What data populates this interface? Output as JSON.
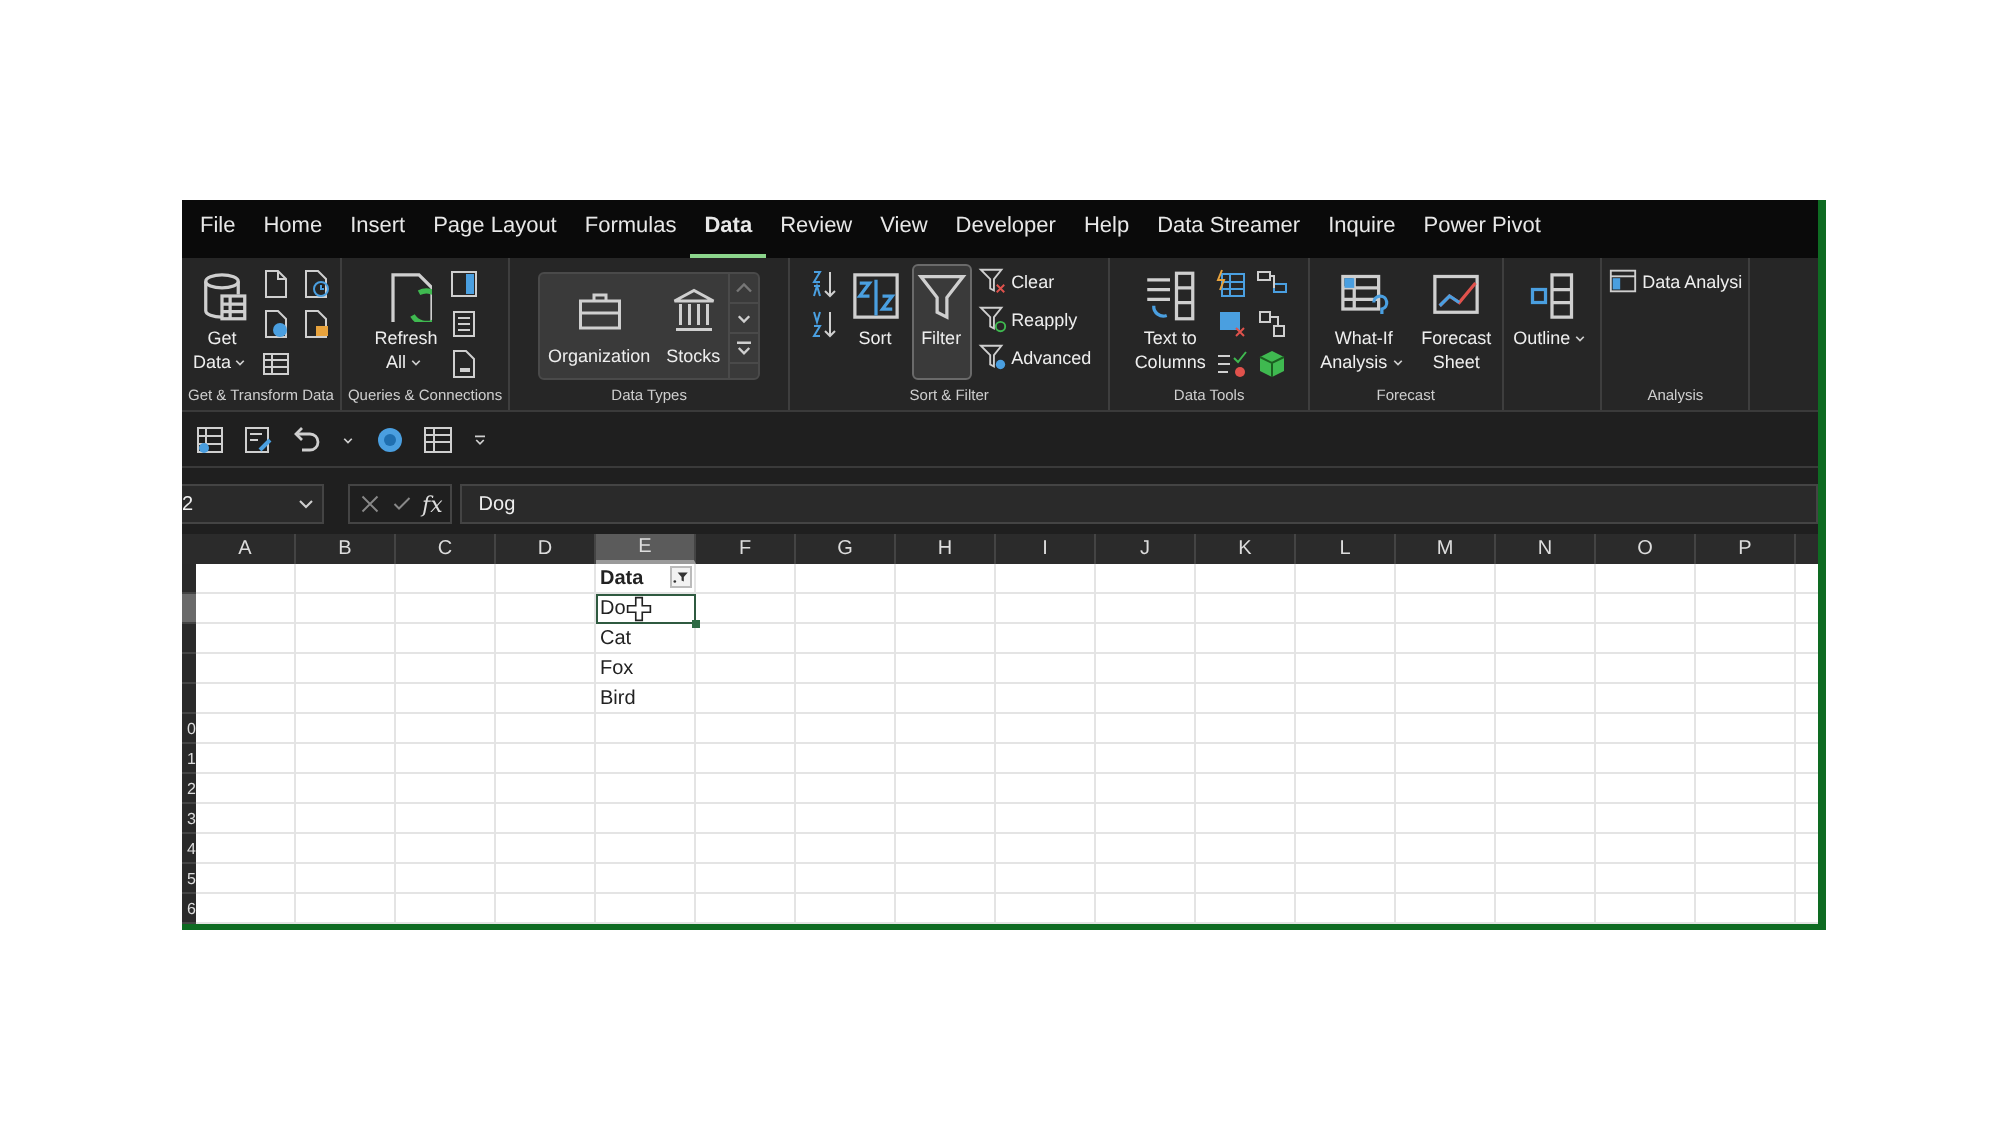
{
  "tabs": [
    {
      "label": "File",
      "selected": false
    },
    {
      "label": "Home",
      "selected": false
    },
    {
      "label": "Insert",
      "selected": false
    },
    {
      "label": "Page Layout",
      "selected": false
    },
    {
      "label": "Formulas",
      "selected": false
    },
    {
      "label": "Data",
      "selected": true
    },
    {
      "label": "Review",
      "selected": false
    },
    {
      "label": "View",
      "selected": false
    },
    {
      "label": "Developer",
      "selected": false
    },
    {
      "label": "Help",
      "selected": false
    },
    {
      "label": "Data Streamer",
      "selected": false
    },
    {
      "label": "Inquire",
      "selected": false
    },
    {
      "label": "Power Pivot",
      "selected": false
    }
  ],
  "ribbon": {
    "groups": [
      {
        "label": "Get & Transform Data",
        "items": [
          {
            "kind": "large",
            "lines": [
              "Get",
              "Data"
            ],
            "dropdown": true,
            "pressed": false
          },
          {
            "kind": "icons"
          }
        ]
      },
      {
        "label": "Queries & Connections",
        "items": [
          {
            "kind": "large",
            "lines": [
              "Refresh",
              "All"
            ],
            "dropdown": true,
            "pressed": false
          },
          {
            "kind": "icons"
          }
        ]
      },
      {
        "label": "Data Types",
        "items": [
          {
            "kind": "gallery",
            "entries": [
              {
                "label": "Organization"
              },
              {
                "label": "Stocks"
              }
            ]
          }
        ]
      },
      {
        "label": "Sort & Filter",
        "items": [
          {
            "kind": "icons"
          },
          {
            "kind": "large",
            "lines": [
              "Sort"
            ],
            "dropdown": false,
            "pressed": false
          },
          {
            "kind": "large",
            "lines": [
              "Filter"
            ],
            "dropdown": false,
            "pressed": true
          },
          {
            "kind": "list",
            "entries": [
              {
                "label": "Clear"
              },
              {
                "label": "Reapply"
              },
              {
                "label": "Advanced"
              }
            ]
          }
        ]
      },
      {
        "label": "Data Tools",
        "items": [
          {
            "kind": "large",
            "lines": [
              "Text to",
              "Columns"
            ],
            "dropdown": false,
            "pressed": false
          },
          {
            "kind": "icons"
          }
        ]
      },
      {
        "label": "Forecast",
        "items": [
          {
            "kind": "large",
            "lines": [
              "What-If",
              "Analysis"
            ],
            "dropdown": true,
            "pressed": false
          },
          {
            "kind": "large",
            "lines": [
              "Forecast",
              "Sheet"
            ],
            "dropdown": false,
            "pressed": false
          }
        ]
      },
      {
        "items": [
          {
            "kind": "large",
            "lines": [
              "Outline"
            ],
            "dropdown": true,
            "pressed": false
          }
        ]
      },
      {
        "label": "Analysis",
        "items": [
          {
            "kind": "list",
            "entries": [
              {
                "label": "Data Analysi"
              }
            ]
          }
        ]
      }
    ]
  },
  "formula_bar": {
    "name_box": "2",
    "fx": "fx",
    "formula": "Dog"
  },
  "sheet": {
    "columns": [
      {
        "label": "A",
        "selected": false
      },
      {
        "label": "B",
        "selected": false
      },
      {
        "label": "C",
        "selected": false
      },
      {
        "label": "D",
        "selected": false
      },
      {
        "label": "E",
        "selected": true
      },
      {
        "label": "F",
        "selected": false
      },
      {
        "label": "G",
        "selected": false
      },
      {
        "label": "H",
        "selected": false
      },
      {
        "label": "I",
        "selected": false
      },
      {
        "label": "J",
        "selected": false
      },
      {
        "label": "K",
        "selected": false
      },
      {
        "label": "L",
        "selected": false
      },
      {
        "label": "M",
        "selected": false
      },
      {
        "label": "N",
        "selected": false
      },
      {
        "label": "O",
        "selected": false
      },
      {
        "label": "P",
        "selected": false
      }
    ],
    "rows": [
      {
        "selected": false,
        "cells": [
          {
            "kind": "header",
            "text": "Data",
            "selected": false
          }
        ]
      },
      {
        "selected": true,
        "cells": [
          {
            "kind": "plain",
            "text": "Do",
            "selected": true
          }
        ]
      },
      {
        "selected": false,
        "cells": [
          {
            "kind": "plain",
            "text": "Cat",
            "selected": false
          }
        ]
      },
      {
        "selected": false,
        "cells": [
          {
            "kind": "plain",
            "text": "Fox",
            "selected": false
          }
        ]
      },
      {
        "selected": false,
        "cells": [
          {
            "kind": "plain",
            "text": "Bird",
            "selected": false
          }
        ]
      },
      {
        "selected": false,
        "header": "0",
        "cells": []
      },
      {
        "selected": false,
        "header": "1",
        "cells": []
      },
      {
        "selected": false,
        "header": "2",
        "cells": []
      },
      {
        "selected": false,
        "header": "3",
        "cells": []
      },
      {
        "selected": false,
        "header": "4",
        "cells": []
      },
      {
        "selected": false,
        "header": "5",
        "cells": []
      },
      {
        "selected": false,
        "header": "6",
        "cells": []
      }
    ]
  }
}
